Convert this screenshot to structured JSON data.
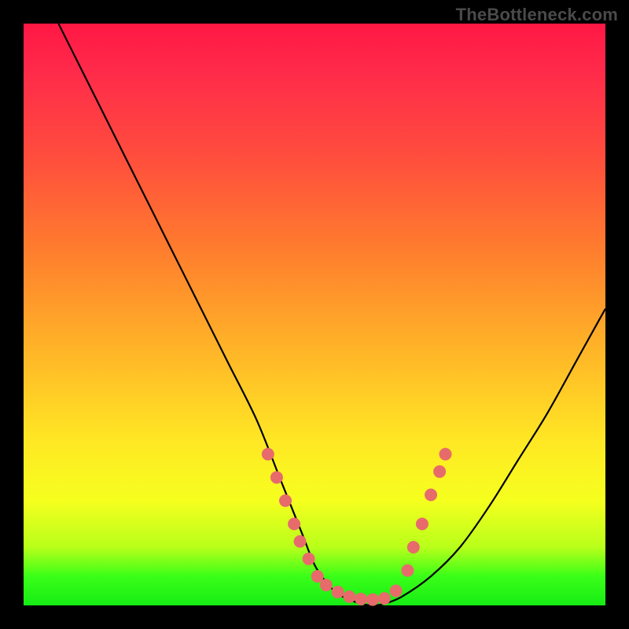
{
  "watermark": "TheBottleneck.com",
  "chart_data": {
    "type": "line",
    "title": "",
    "xlabel": "",
    "ylabel": "",
    "x_range": [
      0,
      100
    ],
    "y_range": [
      0,
      100
    ],
    "series": [
      {
        "name": "bottleneck-curve",
        "x": [
          6,
          10,
          15,
          20,
          25,
          30,
          35,
          40,
          44,
          46,
          48,
          50,
          52,
          54,
          56,
          58,
          60,
          62,
          65,
          70,
          75,
          80,
          85,
          90,
          95,
          100
        ],
        "y": [
          100,
          92,
          82,
          72,
          62,
          52,
          42,
          32,
          22,
          17,
          12,
          7,
          4,
          2,
          1,
          0.3,
          0,
          0.3,
          1.5,
          5,
          10,
          17,
          25,
          33,
          42,
          51
        ]
      }
    ],
    "markers": {
      "name": "salmon-dots",
      "color": "#e76b6b",
      "points": [
        {
          "x": 42,
          "y": 26
        },
        {
          "x": 43.5,
          "y": 22
        },
        {
          "x": 45,
          "y": 18
        },
        {
          "x": 46.5,
          "y": 14
        },
        {
          "x": 47.5,
          "y": 11
        },
        {
          "x": 49,
          "y": 8
        },
        {
          "x": 50.5,
          "y": 5
        },
        {
          "x": 52,
          "y": 3.5
        },
        {
          "x": 54,
          "y": 2.3
        },
        {
          "x": 56,
          "y": 1.5
        },
        {
          "x": 58,
          "y": 1.1
        },
        {
          "x": 60,
          "y": 1
        },
        {
          "x": 62,
          "y": 1.2
        },
        {
          "x": 64,
          "y": 2.5
        },
        {
          "x": 66,
          "y": 6
        },
        {
          "x": 67,
          "y": 10
        },
        {
          "x": 68.5,
          "y": 14
        },
        {
          "x": 70,
          "y": 19
        },
        {
          "x": 71.5,
          "y": 23
        },
        {
          "x": 72.5,
          "y": 26
        }
      ]
    },
    "gradient_stops": [
      {
        "pos": 0.0,
        "color": "#ff1744"
      },
      {
        "pos": 0.22,
        "color": "#ff4b3e"
      },
      {
        "pos": 0.55,
        "color": "#ffb128"
      },
      {
        "pos": 0.82,
        "color": "#f6ff1e"
      },
      {
        "pos": 1.0,
        "color": "#16ec15"
      }
    ]
  }
}
